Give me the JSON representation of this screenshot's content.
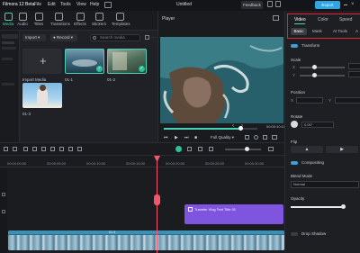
{
  "titlebar": {
    "app_title": "Filmora 12 Beta",
    "menus": [
      "File",
      "Edit",
      "Tools",
      "View",
      "Help"
    ],
    "project_name": "Untitled",
    "feedback_label": "Feedback",
    "export_label": "Export"
  },
  "toolbar": {
    "items": [
      {
        "label": "Media",
        "icon": "media-icon"
      },
      {
        "label": "Audio",
        "icon": "audio-icon"
      },
      {
        "label": "Titles",
        "icon": "titles-icon"
      },
      {
        "label": "Transitions",
        "icon": "transitions-icon"
      },
      {
        "label": "Effects",
        "icon": "effects-icon"
      },
      {
        "label": "Stickers",
        "icon": "stickers-icon"
      },
      {
        "label": "Templates",
        "icon": "templates-icon"
      }
    ]
  },
  "media": {
    "import_dropdown": "Import",
    "record_dropdown": "Record",
    "search_placeholder": "Search media",
    "import_label": "Import Media",
    "clips": [
      {
        "name": "01-1",
        "selected": true
      },
      {
        "name": "01-2",
        "selected": true
      },
      {
        "name": "01-3",
        "selected": false
      }
    ]
  },
  "player": {
    "title": "Player",
    "timecode": "00:00:10:15",
    "quality": "Full Quality",
    "progress": 0.82
  },
  "right_panel": {
    "tabs": [
      "Video",
      "Color",
      "Speed"
    ],
    "subtabs": [
      "Basic",
      "Mask",
      "AI Tools",
      "A"
    ],
    "transform_label": "Transform",
    "scale_label": "Scale",
    "scale_x": "X",
    "scale_y": "Y",
    "position_label": "Position",
    "pos_x": "X",
    "pos_y": "Y",
    "rotate_label": "Rotate",
    "rotate_value": "0.00°",
    "flip_label": "Flip",
    "compositing_label": "Compositing",
    "blend_mode_label": "Blend Mode",
    "blend_mode_value": "Normal",
    "opacity_label": "Opacity",
    "drop_shadow_label": "Drop Shadow"
  },
  "timeline": {
    "timecodes": [
      "00:00:00:00",
      "00:00:05:00",
      "00:00:10:00",
      "00:00:15:00",
      "00:00:20:00",
      "00:00:25:00",
      "00:00:30:00"
    ],
    "title_clip": "Traveler Vlog Text Title 01",
    "video_clip_label": "01-3"
  },
  "colors": {
    "accent": "#2bc29a",
    "title_clip": "#7f55e0",
    "playhead": "#f3566c",
    "highlight_border": "#e8213b",
    "export_button": "#2fa7e5"
  }
}
